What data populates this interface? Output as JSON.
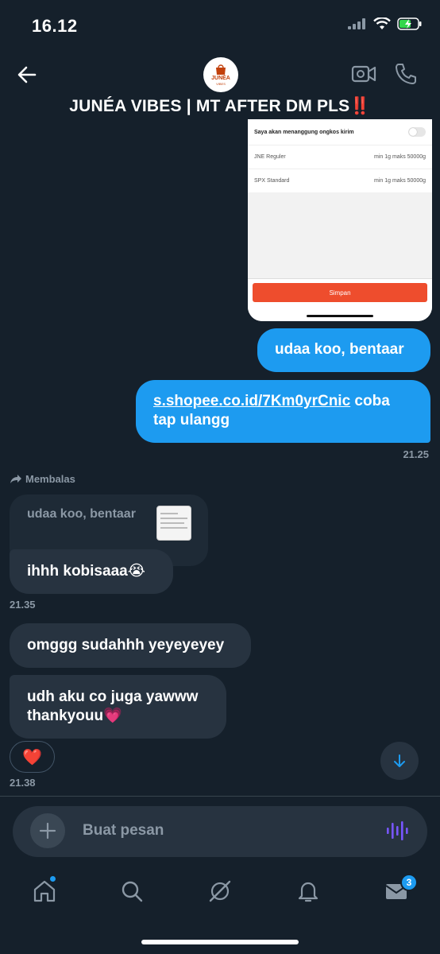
{
  "status_bar": {
    "time": "16.12"
  },
  "header": {
    "avatar_text_1": "JUNÉA",
    "avatar_text_2": "VIBES",
    "title": "JUNÉA VIBES | MT AFTER DM PLS‼️"
  },
  "shared_screenshot": {
    "toggle_label": "Saya akan menanggung ongkos kirim",
    "options": [
      {
        "name": "JNE Reguler",
        "detail": "min 1g maks 50000g"
      },
      {
        "name": "SPX Standard",
        "detail": "min 1g maks 50000g"
      }
    ],
    "save_label": "Simpan"
  },
  "messages": {
    "out_1": "udaa koo, bentaar",
    "out_2_link": "s.shopee.co.id/7Km0yrCnic",
    "out_2_text": " coba tap ulangg",
    "time_1": "21.25",
    "reply_label": "Membalas",
    "quoted_text": "udaa koo, bentaar",
    "in_1": "ihhh kobisaaa😭",
    "time_2": "21.35",
    "in_2": "omggg sudahhh yeyeyeyey",
    "in_3": "udh aku co juga yawww thankyouu💗",
    "reaction": "❤️",
    "time_3": "21.38"
  },
  "composer": {
    "placeholder": "Buat pesan"
  },
  "nav": {
    "messages_badge": "3"
  },
  "colors": {
    "background": "#15202b",
    "accent": "#1d9bf0",
    "bubble_in": "#273340"
  }
}
